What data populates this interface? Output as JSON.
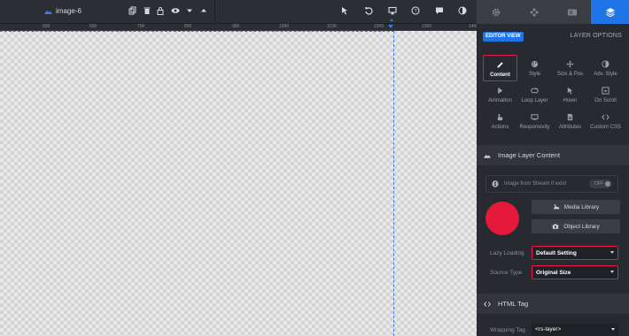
{
  "toolbar": {
    "layer_name": "image-6"
  },
  "ruler": {
    "ticks": [
      "500",
      "600",
      "700",
      "800",
      "900",
      "1000",
      "1100",
      "1200",
      "1300",
      "1400"
    ]
  },
  "panel": {
    "editor_view": "EDITOR VIEW",
    "layer_options": "LAYER OPTIONS",
    "options": [
      {
        "label": "Content",
        "icon": "pencil-icon"
      },
      {
        "label": "Style",
        "icon": "palette-icon"
      },
      {
        "label": "Size & Pos",
        "icon": "move-icon"
      },
      {
        "label": "Adv. Style",
        "icon": "contrast-icon"
      },
      {
        "label": "Animation",
        "icon": "play-icon"
      },
      {
        "label": "Loop Layer",
        "icon": "loop-icon"
      },
      {
        "label": "Hover",
        "icon": "pointer-icon"
      },
      {
        "label": "On Scroll",
        "icon": "scroll-icon"
      },
      {
        "label": "Actions",
        "icon": "hand-icon"
      },
      {
        "label": "Responsivity",
        "icon": "devices-icon"
      },
      {
        "label": "Attributes",
        "icon": "document-icon"
      },
      {
        "label": "Custom CSS",
        "icon": "code-icon"
      }
    ],
    "image_section": {
      "title": "Image Layer Content",
      "stream_label": "Image from Stream if exist",
      "stream_toggle": "OFF",
      "swatch_color": "#e5193b",
      "media_library": "Media Library",
      "object_library": "Object Library",
      "lazy_loading_label": "Lazy Loading",
      "lazy_loading_value": "Default Setting",
      "source_type_label": "Source Type",
      "source_type_value": "Original Size"
    },
    "html_section": {
      "title": "HTML Tag",
      "wrapping_tag_label": "Wrapping Tag",
      "wrapping_tag_value": "<rs-layer>"
    }
  },
  "colors": {
    "accent": "#1f74e8",
    "highlight": "#e5194a"
  }
}
